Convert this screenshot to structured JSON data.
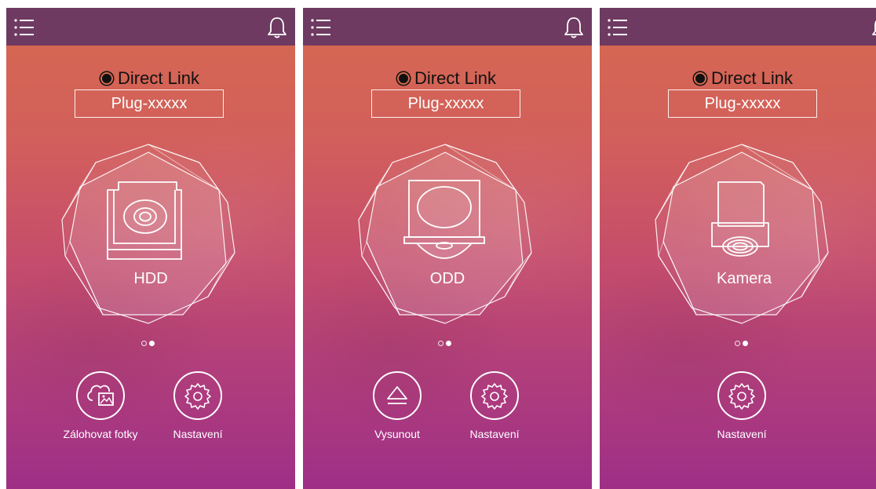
{
  "colors": {
    "topbar": "#6e3a62",
    "gradient_top": "#d6694f",
    "gradient_bottom": "#9e2f86",
    "text_dark": "#111111",
    "text_light": "#ffffff"
  },
  "panels": [
    {
      "connection": {
        "label": "Direct Link"
      },
      "device_name": "Plug-xxxxx",
      "device": {
        "label": "HDD",
        "icon": "hdd-icon"
      },
      "pager": {
        "current": 2,
        "total": 2
      },
      "actions": [
        {
          "label": "Zálohovat fotky",
          "icon": "cloud-photo-backup-icon"
        },
        {
          "label": "Nastavení",
          "icon": "gear-icon"
        }
      ]
    },
    {
      "connection": {
        "label": "Direct Link"
      },
      "device_name": "Plug-xxxxx",
      "device": {
        "label": "ODD",
        "icon": "optical-drive-icon"
      },
      "pager": {
        "current": 2,
        "total": 2
      },
      "actions": [
        {
          "label": "Vysunout",
          "icon": "eject-icon"
        },
        {
          "label": "Nastavení",
          "icon": "gear-icon"
        }
      ]
    },
    {
      "connection": {
        "label": "Direct Link"
      },
      "device_name": "Plug-xxxxx",
      "device": {
        "label": "Kamera",
        "icon": "camera-icon"
      },
      "pager": {
        "current": 2,
        "total": 2
      },
      "actions": [
        {
          "label": "Nastavení",
          "icon": "gear-icon"
        }
      ]
    }
  ]
}
